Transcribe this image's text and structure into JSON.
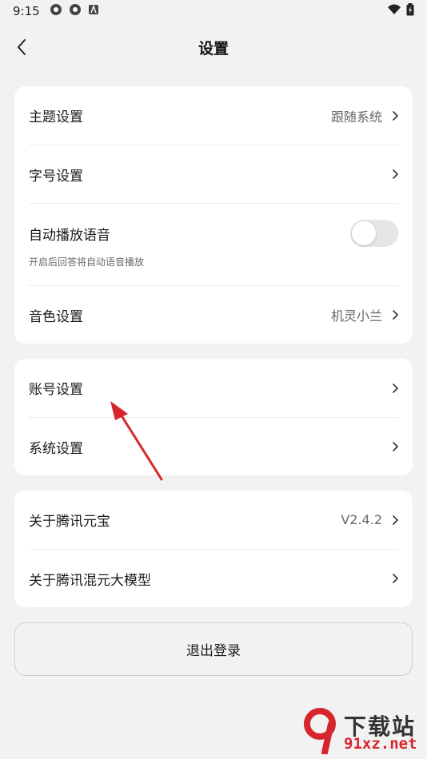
{
  "status_bar": {
    "time": "9:15"
  },
  "header": {
    "title": "设置"
  },
  "card1": {
    "theme": {
      "label": "主题设置",
      "value": "跟随系统"
    },
    "font": {
      "label": "字号设置"
    },
    "autoplay": {
      "label": "自动播放语音",
      "sub": "开启后回答将自动语音播放",
      "enabled": false
    },
    "voice": {
      "label": "音色设置",
      "value": "机灵小兰"
    }
  },
  "card2": {
    "account": {
      "label": "账号设置"
    },
    "system": {
      "label": "系统设置"
    }
  },
  "card3": {
    "about_yuanbao": {
      "label": "关于腾讯元宝",
      "value": "V2.4.2"
    },
    "about_hunyuan": {
      "label": "关于腾讯混元大模型"
    }
  },
  "logout": {
    "label": "退出登录"
  },
  "watermark": {
    "line1": "下载站",
    "line2": "91xz.net"
  },
  "colors": {
    "annotation_arrow": "#d6262c",
    "background": "#f2f2f3",
    "card": "#ffffff"
  }
}
